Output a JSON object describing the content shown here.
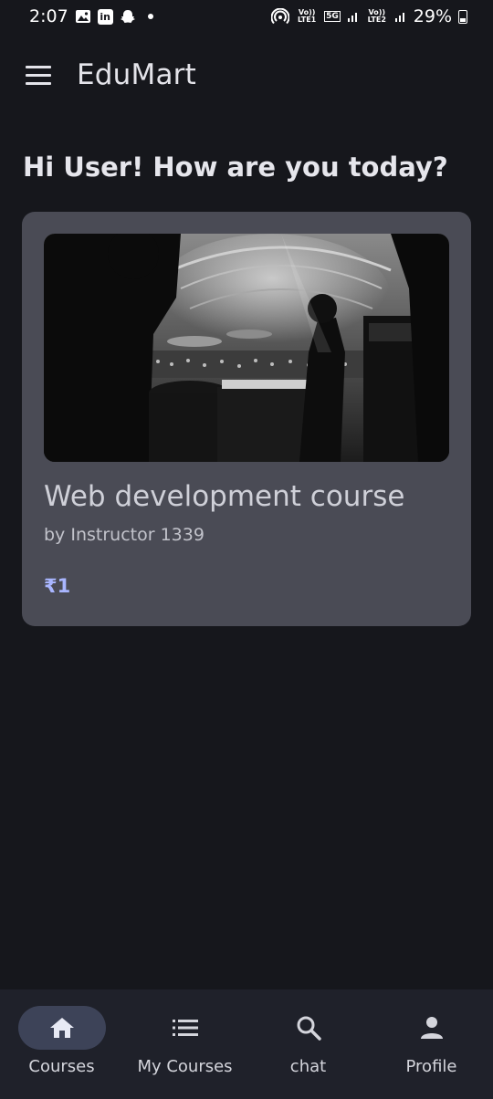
{
  "status_bar": {
    "time": "2:07",
    "lte1": "Vo)) LTE1",
    "network": "5G",
    "lte2": "Vo)) LTE2",
    "battery": "29%",
    "icons": [
      "gallery-icon",
      "linkedin-icon",
      "snapchat-icon",
      "hotspot-icon",
      "signal-icon",
      "battery-icon"
    ]
  },
  "app_bar": {
    "title": "EduMart",
    "menu_icon": "hamburger-menu-icon"
  },
  "greeting": "Hi User! How are you today?",
  "courses": [
    {
      "title": "Web development course",
      "instructor": "by Instructor 1339",
      "price": "₹1",
      "image": "black-and-white concert photo"
    }
  ],
  "bottom_nav": {
    "items": [
      {
        "label": "Courses",
        "icon": "home-icon",
        "active": true
      },
      {
        "label": "My Courses",
        "icon": "list-icon",
        "active": false
      },
      {
        "label": "chat",
        "icon": "search-icon",
        "active": false
      },
      {
        "label": "Profile",
        "icon": "person-icon",
        "active": false
      }
    ]
  },
  "colors": {
    "background": "#16171c",
    "card": "#4a4b55",
    "price": "#a9b6ff",
    "nav_background": "#1f212a",
    "nav_active_pill": "#3d4358"
  }
}
